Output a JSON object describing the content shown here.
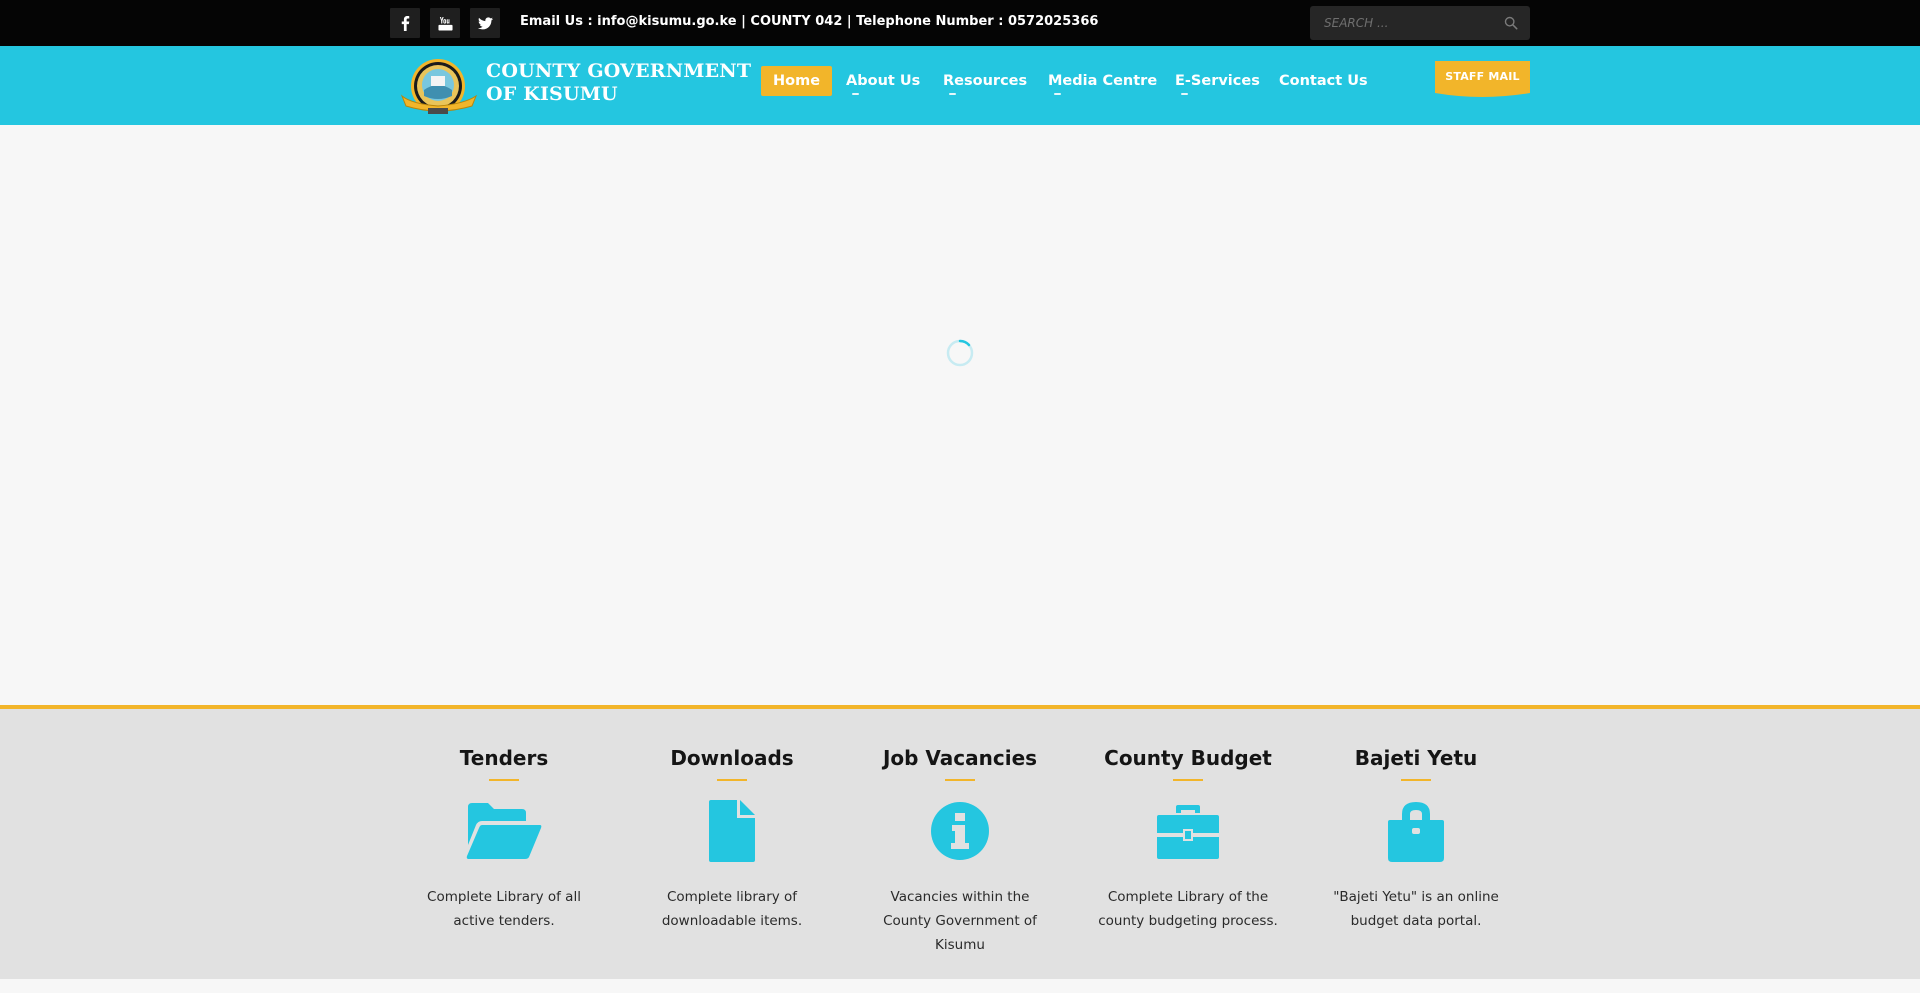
{
  "topbar": {
    "social": [
      {
        "name": "facebook-icon"
      },
      {
        "name": "youtube-icon"
      },
      {
        "name": "twitter-icon"
      }
    ],
    "contact_line": "Email Us : info@kisumu.go.ke | COUNTY 042 | Telephone Number : 0572025366",
    "search_placeholder": "SEARCH ..."
  },
  "header": {
    "logo_line1": "COUNTY GOVERNMENT",
    "logo_line2": "OF KISUMU",
    "nav": [
      {
        "label": "Home",
        "active": true
      },
      {
        "label": "About Us",
        "active": false
      },
      {
        "label": "Resources",
        "active": false
      },
      {
        "label": "Media Centre",
        "active": false
      },
      {
        "label": "E-Services",
        "active": false
      },
      {
        "label": "Contact Us",
        "active": false
      }
    ],
    "staff_mail": "STAFF MAIL"
  },
  "main": {
    "loading": true
  },
  "features": [
    {
      "title": "Tenders",
      "icon": "folder-open-icon",
      "description": "Complete Library of all active tenders."
    },
    {
      "title": "Downloads",
      "icon": "file-icon",
      "description": "Complete library of downloadable items."
    },
    {
      "title": "Job Vacancies",
      "icon": "info-circle-icon",
      "description": "Vacancies within the County Government of Kisumu"
    },
    {
      "title": "County Budget",
      "icon": "briefcase-icon",
      "description": "Complete Library of the county budgeting process."
    },
    {
      "title": "Bajeti Yetu",
      "icon": "lock-icon",
      "description": "\"Bajeti Yetu\" is an online budget data portal."
    }
  ],
  "colors": {
    "accent": "#24c6e0",
    "highlight": "#f2b52a",
    "topbar": "#050505"
  }
}
